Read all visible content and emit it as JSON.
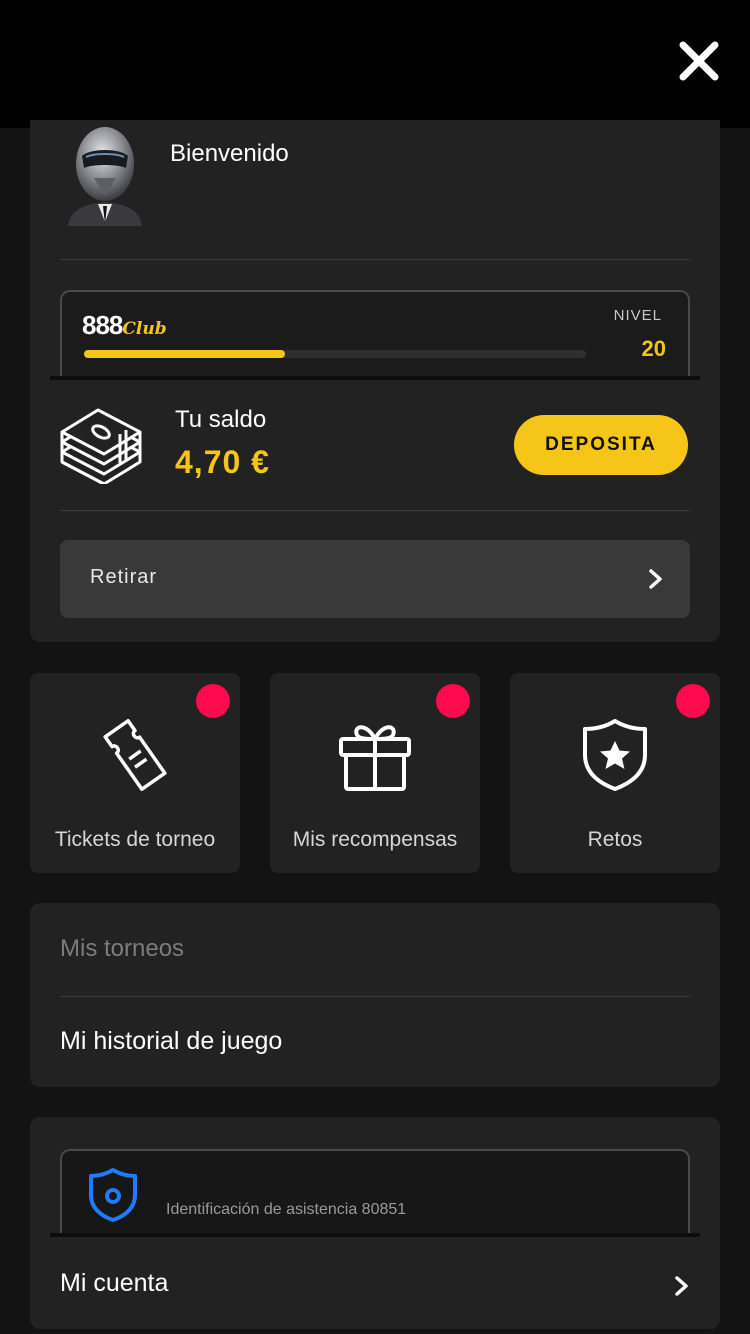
{
  "header": {
    "close_icon": "close-icon"
  },
  "profile": {
    "welcome": "Bienvenido",
    "avatar_icon": "helmet-avatar"
  },
  "club": {
    "logo_number": "888",
    "logo_word": "Club",
    "level_label": "NIVEL",
    "level_value": "20",
    "progress": 0.4,
    "progress_color": "#f5c518"
  },
  "balance": {
    "label": "Tu saldo",
    "value": "4,70 €",
    "deposit_label": "DEPOSITA",
    "money_icon": "money-stack-icon"
  },
  "withdraw": {
    "label": "Retirar"
  },
  "tiles": [
    {
      "label": "Tickets de torneo",
      "icon": "ticket-icon",
      "badge": true
    },
    {
      "label": "Mis recompensas",
      "icon": "gift-icon",
      "badge": true
    },
    {
      "label": "Retos",
      "icon": "shield-star-icon",
      "badge": true
    }
  ],
  "menu": {
    "tournaments": "Mis torneos",
    "history": "Mi historial de juego"
  },
  "support": {
    "text": "Identificación de asistencia 80851",
    "icon": "shield-icon"
  },
  "account": {
    "label": "Mi cuenta"
  },
  "colors": {
    "accent": "#f5c518",
    "badge": "#ff0a4f",
    "support_blue": "#1f7bff",
    "background": "#131313",
    "card": "#222222"
  }
}
